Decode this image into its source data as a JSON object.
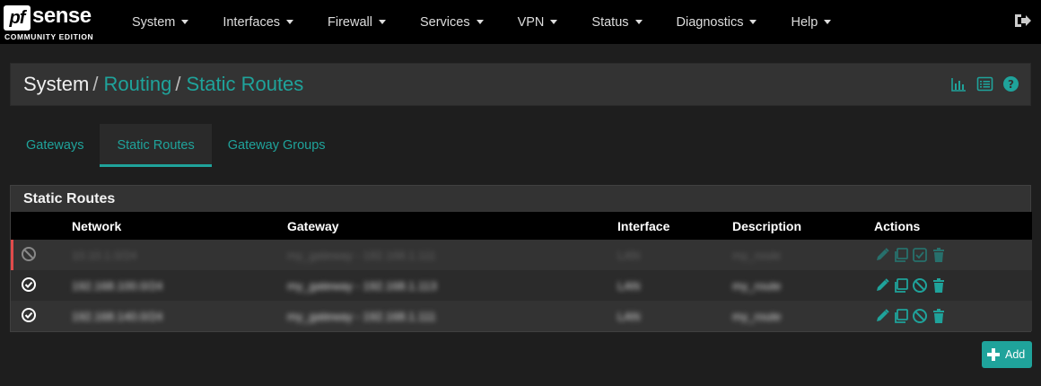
{
  "brand": {
    "logo_pf": "pf",
    "logo_sense": "sense",
    "edition": "COMMUNITY EDITION"
  },
  "nav": {
    "items": [
      {
        "label": "System"
      },
      {
        "label": "Interfaces"
      },
      {
        "label": "Firewall"
      },
      {
        "label": "Services"
      },
      {
        "label": "VPN"
      },
      {
        "label": "Status"
      },
      {
        "label": "Diagnostics"
      },
      {
        "label": "Help"
      }
    ]
  },
  "breadcrumb": {
    "system": "System",
    "routing": "Routing",
    "static_routes": "Static Routes",
    "separator": "/"
  },
  "tabs": [
    {
      "label": "Gateways"
    },
    {
      "label": "Static Routes"
    },
    {
      "label": "Gateway Groups"
    }
  ],
  "table": {
    "title": "Static Routes",
    "headers": {
      "network": "Network",
      "gateway": "Gateway",
      "interface": "Interface",
      "description": "Description",
      "actions": "Actions"
    },
    "rows": [
      {
        "status": "disabled",
        "network": "10.10.1.0/24",
        "gateway": "my_gateway - 192.168.1.111",
        "interface": "LAN",
        "description": "my_route"
      },
      {
        "status": "enabled",
        "network": "192.168.100.0/24",
        "gateway": "my_gateway - 192.168.1.113",
        "interface": "LAN",
        "description": "my_route"
      },
      {
        "status": "enabled",
        "network": "192.168.140.0/24",
        "gateway": "my_gateway - 192.168.1.111",
        "interface": "LAN",
        "description": "my_route"
      }
    ]
  },
  "add_button": {
    "label": "Add"
  },
  "colors": {
    "accent": "#1fa39b",
    "disabled_marker": "#e04b4b",
    "navbar": "#000000"
  }
}
